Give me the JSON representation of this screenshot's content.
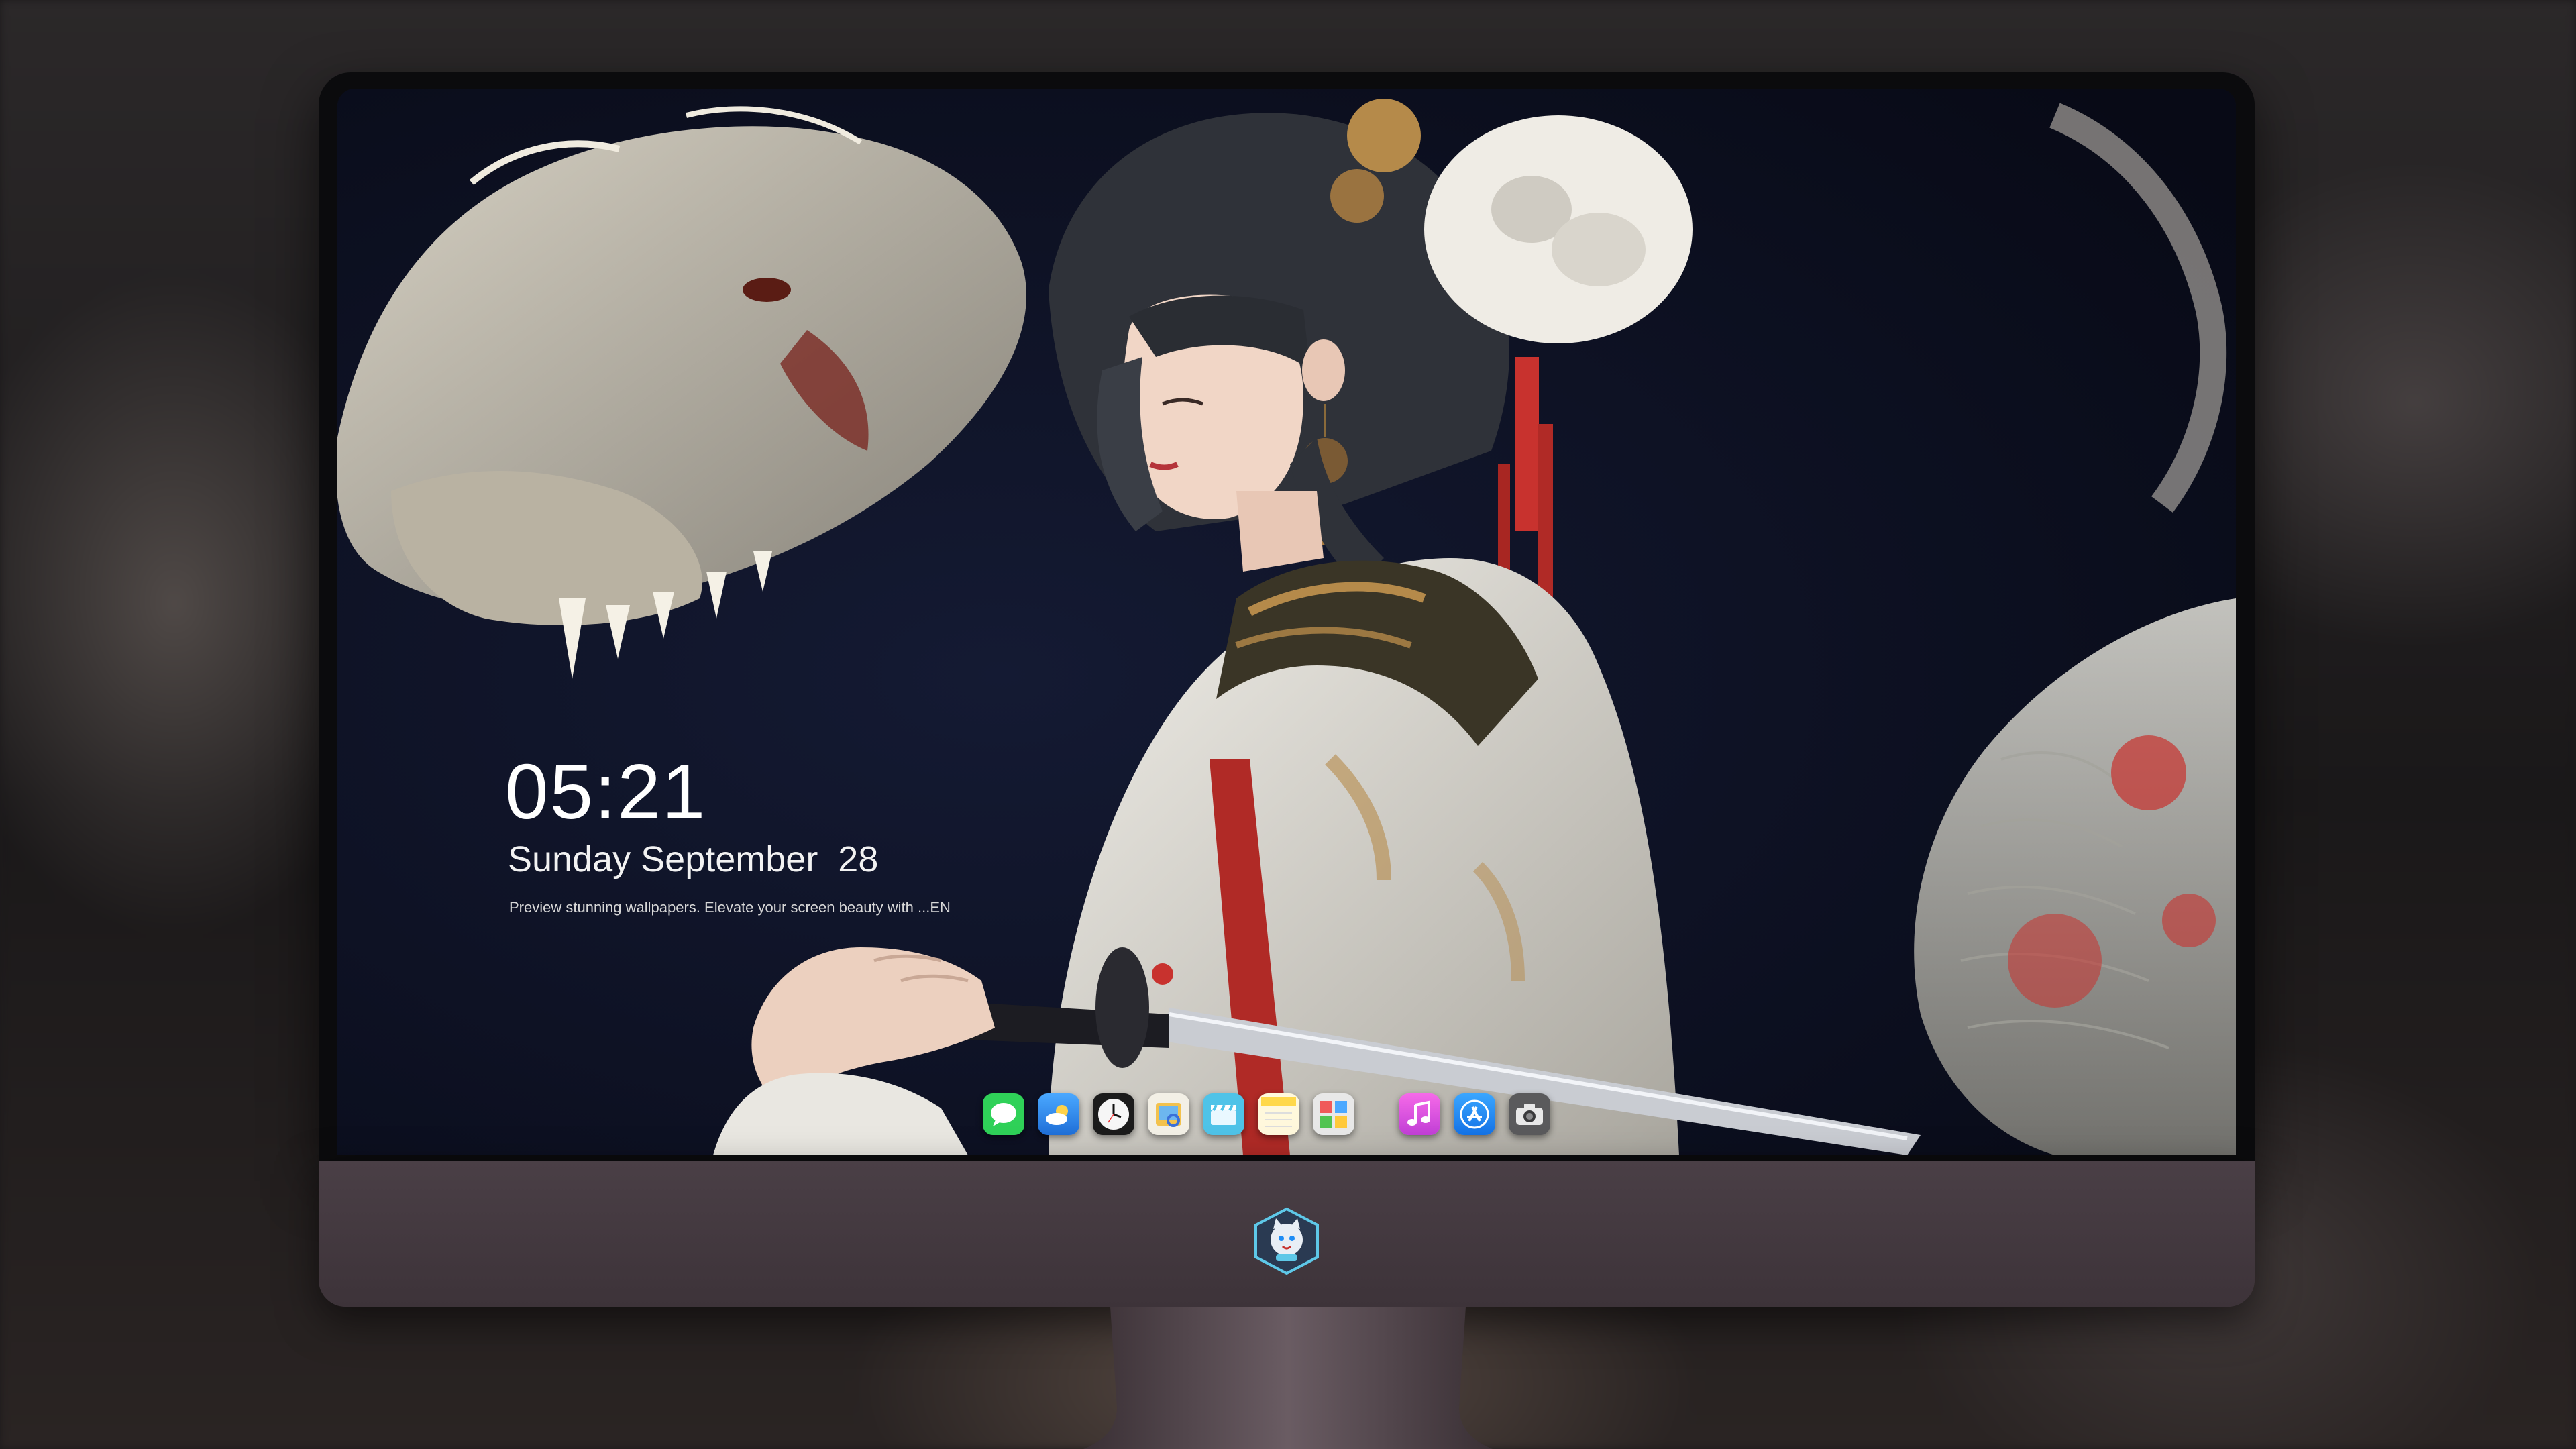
{
  "lockscreen": {
    "time": "05:21",
    "date": "Sunday September  28",
    "tagline": "Preview stunning wallpapers. Elevate your screen beauty with ...EN"
  },
  "dock": {
    "apps": [
      {
        "name": "Messages",
        "icon": "messages-icon",
        "color": "#2fd158"
      },
      {
        "name": "Weather",
        "icon": "weather-icon",
        "color": "#2f8ff0"
      },
      {
        "name": "Clock",
        "icon": "clock-icon",
        "color": "#f4f4f4"
      },
      {
        "name": "Preview",
        "icon": "preview-icon",
        "color": "#f3c24d"
      },
      {
        "name": "Clips",
        "icon": "clips-icon",
        "color": "#4fc3e8"
      },
      {
        "name": "Notes",
        "icon": "notes-icon",
        "color": "#ffd84a"
      },
      {
        "name": "Photo Booth",
        "icon": "photo-booth-icon",
        "color": "#d9d9d9"
      },
      {
        "name": "Music",
        "icon": "music-icon",
        "color": "#e04fe3"
      },
      {
        "name": "App Store",
        "icon": "app-store-icon",
        "color": "#1d8cf5"
      },
      {
        "name": "Camera",
        "icon": "camera-icon",
        "color": "#8a8a8a"
      }
    ]
  },
  "chin_logo": {
    "icon": "cat-mascot-logo-icon",
    "color": "#5ec8e8"
  },
  "colors": {
    "wallpaper_bg": "#0d1020",
    "chin": "#4a3f46",
    "accent_red": "#c8322e"
  }
}
